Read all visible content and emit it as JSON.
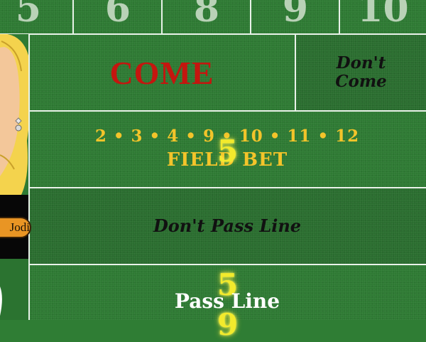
{
  "table": {
    "place_numbers": [
      "5",
      "6",
      "8",
      "9",
      "10"
    ],
    "come_label": "COME",
    "dont_come_label": "Don't Come",
    "field_numbers": "2 • 3 • 4 • 9 • 10 • 11 • 12",
    "field_bet_label": "FIELD BET",
    "dont_pass_label": "Don't Pass Line",
    "pass_line_label": "Pass Line",
    "colors": {
      "felt": "#2e7a33",
      "come": "#c4160f",
      "field": "#f3c42a",
      "point": "#f2ea2c"
    }
  },
  "chips": {
    "field_point": "5",
    "pass_point": "5",
    "pass_point_lower": "9"
  },
  "player": {
    "name": "Jodi",
    "avatar": "blonde-woman-avatar"
  }
}
